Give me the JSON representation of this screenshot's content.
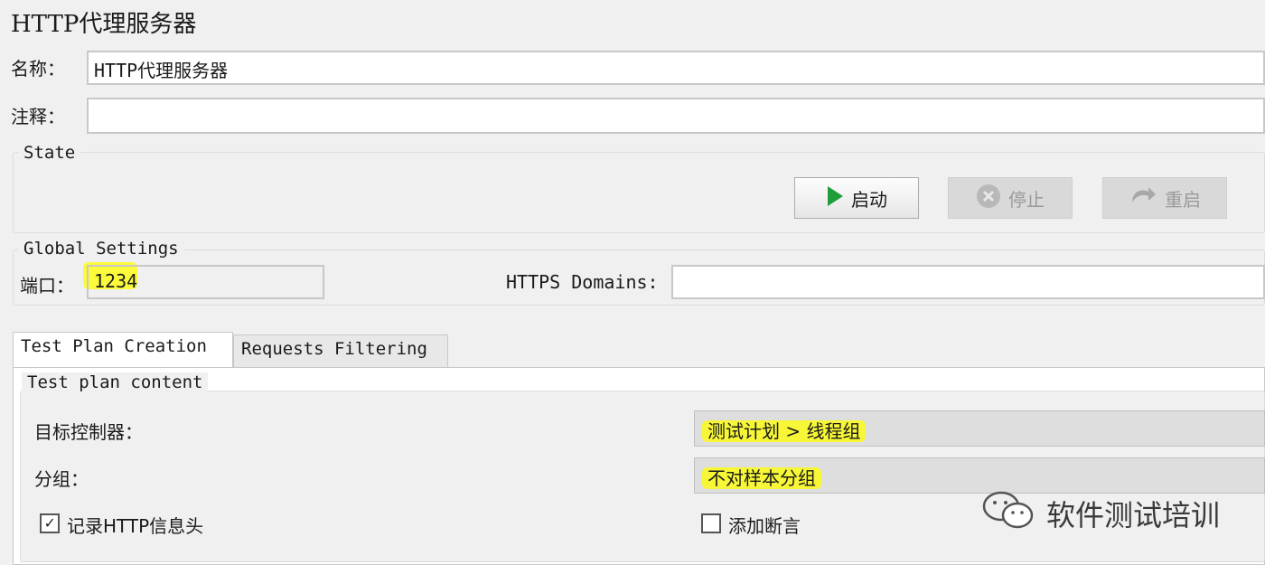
{
  "window_title": "HTTP代理服务器",
  "name_field": {
    "label": "名称：",
    "value": "HTTP代理服务器"
  },
  "comment_field": {
    "label": "注释：",
    "value": ""
  },
  "state": {
    "legend": "State",
    "start_label": "启动",
    "stop_label": "停止",
    "restart_label": "重启"
  },
  "global_settings": {
    "legend": "Global Settings",
    "port_label": "端口：",
    "port_value": "1234",
    "https_label": "HTTPS Domains:",
    "https_value": ""
  },
  "tabs": [
    {
      "label": "Test Plan Creation",
      "active": true
    },
    {
      "label": "Requests Filtering",
      "active": false
    }
  ],
  "test_plan_content": {
    "legend": "Test plan content",
    "target_controller_label": "目标控制器：",
    "target_controller_value": "测试计划 > 线程组",
    "grouping_label": "分组：",
    "grouping_value": "不对样本分组",
    "record_headers_label": "记录HTTP信息头",
    "record_headers_checked": true,
    "add_assertion_label": "添加断言",
    "add_assertion_checked": false
  },
  "watermark": {
    "text": "软件测试培训",
    "icon": "wechat-icon"
  },
  "colors": {
    "highlight": "#ffff00",
    "start_icon": "#1e9e3a"
  }
}
